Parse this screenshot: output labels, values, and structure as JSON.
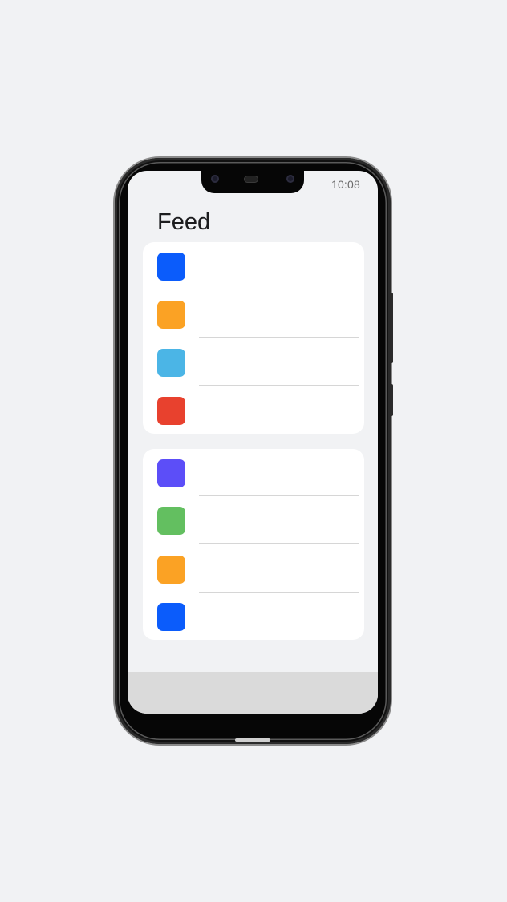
{
  "status_bar": {
    "time": "10:08"
  },
  "page": {
    "title": "Feed"
  },
  "groups": [
    {
      "items": [
        {
          "icon": "square-icon",
          "color": "#0b5cfb",
          "label": ""
        },
        {
          "icon": "square-icon",
          "color": "#fba224",
          "label": ""
        },
        {
          "icon": "square-icon",
          "color": "#4bb5e6",
          "label": ""
        },
        {
          "icon": "square-icon",
          "color": "#e8412e",
          "label": ""
        }
      ]
    },
    {
      "items": [
        {
          "icon": "square-icon",
          "color": "#5c4ef8",
          "label": ""
        },
        {
          "icon": "square-icon",
          "color": "#63bf60",
          "label": ""
        },
        {
          "icon": "square-icon",
          "color": "#fba224",
          "label": ""
        },
        {
          "icon": "square-icon",
          "color": "#0b5cfb",
          "label": ""
        }
      ]
    }
  ]
}
